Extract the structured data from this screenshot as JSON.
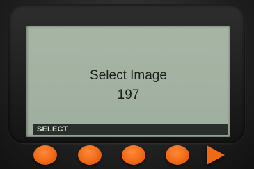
{
  "screen": {
    "title": "Select Image",
    "value": "197"
  },
  "softkey_bar": {
    "label": "SELECT"
  },
  "buttons": [
    {
      "icon": "orange-round-button"
    },
    {
      "icon": "orange-round-button"
    },
    {
      "icon": "orange-round-button"
    },
    {
      "icon": "orange-round-button"
    },
    {
      "icon": "orange-right-arrow-button"
    }
  ],
  "colors": {
    "lcd_background": "#a2b1a1",
    "text": "#1c1f1c",
    "softkey_bar": "#2b2f2b",
    "button": "#f06a16"
  }
}
